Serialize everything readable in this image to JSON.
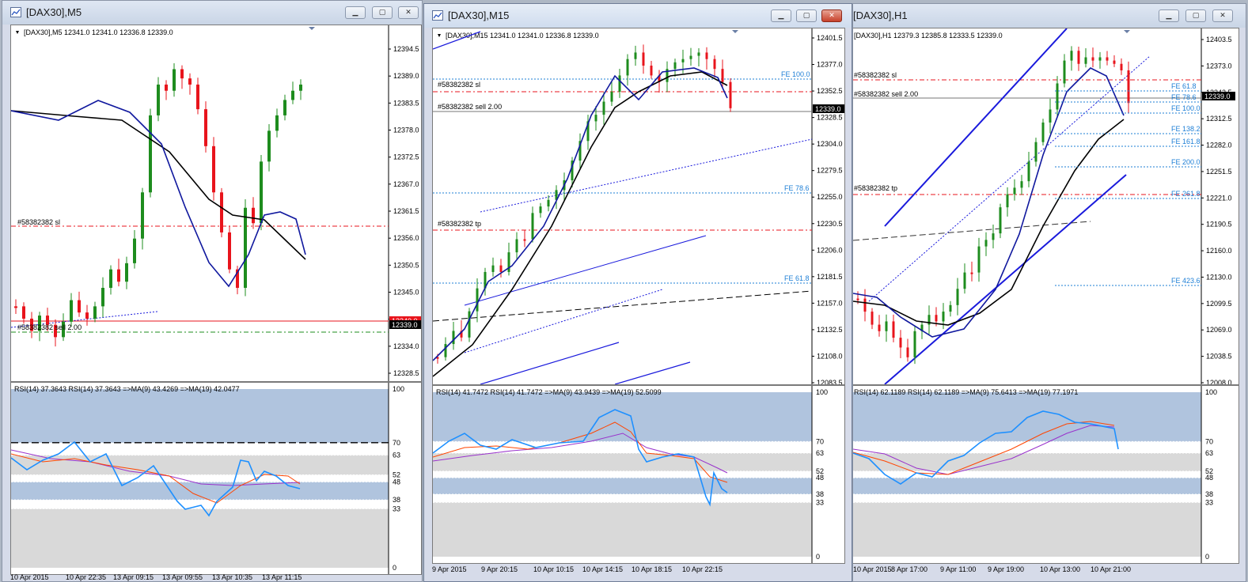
{
  "colors": {
    "bull": "#1e8c1e",
    "bear": "#e8141c",
    "ma_fast": "#10189e",
    "ma_slow": "#000000",
    "rsi": "#1e90ff",
    "rsi_ma9": "#ff4500",
    "rsi_ma19": "#9932cc",
    "fe": "#1e7fd6",
    "sl": "#e8141c",
    "entry": "#1e8c1e"
  },
  "windows": [
    {
      "title": "[DAX30],M5",
      "header": "[DAX30],M5  12341.0 12341.0 12336.8 12339.0",
      "y_axis": [
        "12394.5",
        "12389.0",
        "12383.5",
        "12378.0",
        "12372.5",
        "12367.0",
        "12361.5",
        "12356.0",
        "12350.5",
        "12345.0",
        "12339.0",
        "12334.0",
        "12328.5"
      ],
      "price_tag_red": "12340.0",
      "price_tag_black": "12339.0",
      "order_labels": [
        "#58382382 sl",
        "#58382382 sell 2.00"
      ],
      "fe_labels": [],
      "rsi_header": "RSI(14) 37.3643  RSI(14) 37.3643  =>MA(9) 43.4269  =>MA(19) 42.0477",
      "rsi_levels": [
        "100",
        "70",
        "63",
        "52",
        "48",
        "38",
        "33",
        "0"
      ],
      "x_axis": [
        "10 Apr 2015",
        "10 Apr 22:35",
        "13 Apr 09:15",
        "13 Apr 09:55",
        "13 Apr 10:35",
        "13 Apr 11:15"
      ]
    },
    {
      "title": "[DAX30],M15",
      "header": "[DAX30],M15  12341.0 12341.0 12336.8 12339.0",
      "y_axis": [
        "12401.5",
        "12377.0",
        "12352.5",
        "12328.5",
        "12304.0",
        "12279.5",
        "12255.0",
        "12230.5",
        "12206.0",
        "12181.5",
        "12157.0",
        "12132.5",
        "12108.0",
        "12083.5"
      ],
      "price_tag_black": "12339.0",
      "order_labels": [
        "#58382382 sl",
        "#58382382 sell 2.00",
        "#58382382 tp"
      ],
      "fe_labels": [
        "FE 100.0",
        "FE 78.6",
        "FE 61.8"
      ],
      "rsi_header": "RSI(14) 41.7472  RSI(14) 41.7472  =>MA(9) 43.9439  =>MA(19) 52.5099",
      "rsi_levels": [
        "100",
        "70",
        "63",
        "52",
        "48",
        "38",
        "33",
        "0"
      ],
      "x_axis": [
        "9 Apr 2015",
        "9 Apr 20:15",
        "10 Apr 10:15",
        "10 Apr 14:15",
        "10 Apr 18:15",
        "10 Apr 22:15"
      ]
    },
    {
      "title": "[DAX30],H1",
      "header": "[DAX30],H1  12379.3 12385.8 12333.5 12339.0",
      "y_axis": [
        "12403.5",
        "12373.0",
        "12342.5",
        "12312.5",
        "12282.0",
        "12251.5",
        "12221.0",
        "12190.5",
        "12160.0",
        "12130.0",
        "12099.5",
        "12069.0",
        "12038.5",
        "12008.0"
      ],
      "price_tag_black": "12339.0",
      "order_labels": [
        "#58382382 sl",
        "#58382382 sell 2.00",
        "#58382382 tp"
      ],
      "fe_labels": [
        "FE 61.8",
        "FE 78.6",
        "FE 100.0",
        "FE 138.2",
        "FE 161.8",
        "FE 200.0",
        "FE 261.8",
        "FE 423.6"
      ],
      "rsi_header": "RSI(14) 62.1189  RSI(14) 62.1189  =>MA(9) 75.6413  =>MA(19) 77.1971",
      "rsi_levels": [
        "100",
        "70",
        "63",
        "52",
        "48",
        "38",
        "33",
        "0"
      ],
      "x_axis": [
        "10 Apr 2015",
        "8 Apr 17:00",
        "9 Apr 11:00",
        "9 Apr 19:00",
        "10 Apr 13:00",
        "10 Apr 21:00"
      ]
    }
  ]
}
